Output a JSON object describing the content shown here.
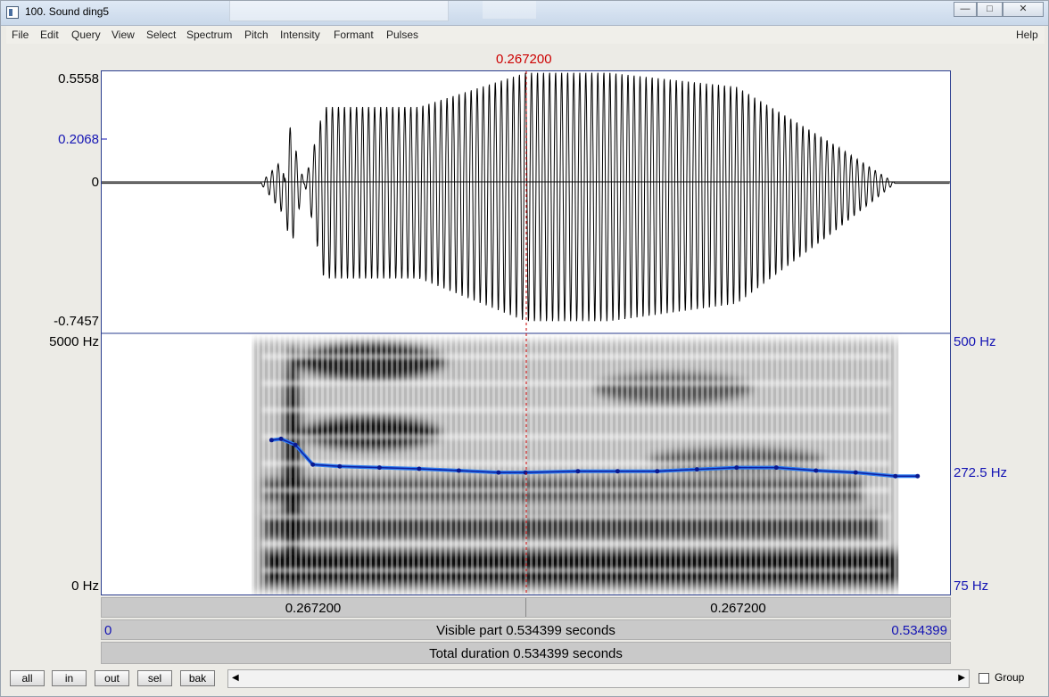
{
  "window": {
    "title": "100. Sound ding5",
    "minimize": "—",
    "maximize": "□",
    "close": "✕"
  },
  "menu": {
    "items": [
      "File",
      "Edit",
      "Query",
      "View",
      "Select",
      "Spectrum",
      "Pitch",
      "Intensity",
      "Formant",
      "Pulses"
    ],
    "help": "Help"
  },
  "cursor_time": "0.267200",
  "waveform": {
    "ymax": "0.5558",
    "ymid": "0.2068",
    "yzero": "0",
    "ymin": "-0.7457"
  },
  "spectrogram": {
    "top": "5000 Hz",
    "bottom": "0 Hz"
  },
  "pitch_axis": {
    "top": "500 Hz",
    "mid": "272.5 Hz",
    "bottom": "75 Hz"
  },
  "time_bar": {
    "left": "0.267200",
    "right": "0.267200"
  },
  "visible_bar": {
    "start": "0",
    "text": "Visible part 0.534399 seconds",
    "end": "0.534399"
  },
  "total_bar": {
    "text": "Total duration 0.534399 seconds"
  },
  "buttons": {
    "all": "all",
    "in": "in",
    "out": "out",
    "sel": "sel",
    "bak": "bak"
  },
  "scroll": {
    "left": "◀",
    "right": "▶"
  },
  "group": "Group",
  "chart_data": [
    {
      "type": "line",
      "ylim": [
        -0.7457,
        0.5558
      ],
      "xlim": [
        0,
        0.534399
      ],
      "x": [
        0.0,
        0.1,
        0.114,
        0.118,
        0.14,
        0.2,
        0.267,
        0.32,
        0.4,
        0.46,
        0.5,
        0.534399
      ],
      "series": [
        {
          "values": [
            0.0,
            0.0,
            0.12,
            -0.3,
            0.38,
            0.38,
            0.55,
            0.55,
            0.48,
            0.2,
            0.0,
            0.0
          ]
        }
      ]
    },
    {
      "type": "line",
      "ylim": [
        75,
        500
      ],
      "xlim": [
        0,
        0.534399
      ],
      "x": [
        0.107,
        0.113,
        0.122,
        0.133,
        0.15,
        0.175,
        0.2,
        0.225,
        0.25,
        0.267,
        0.3,
        0.325,
        0.35,
        0.375,
        0.4,
        0.425,
        0.45,
        0.475,
        0.5,
        0.514
      ],
      "series": [
        {
          "values": [
            328,
            330,
            320,
            288,
            285,
            283,
            281,
            278,
            275,
            275,
            277,
            277,
            277,
            280,
            283,
            283,
            278,
            275,
            269,
            269
          ]
        }
      ]
    }
  ]
}
